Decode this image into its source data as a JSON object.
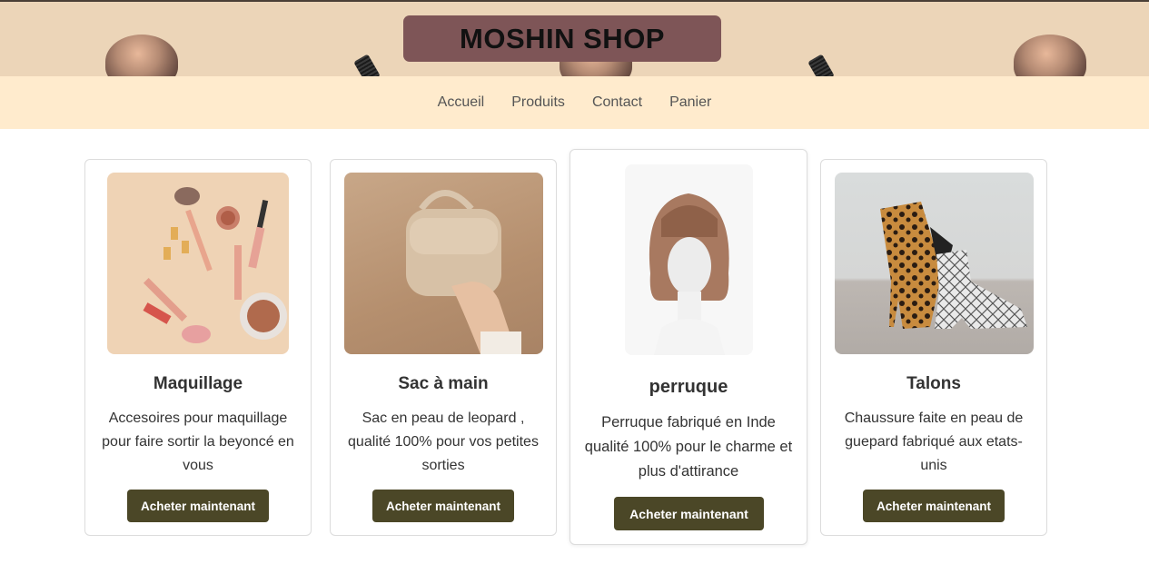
{
  "header": {
    "title": "MOSHIN SHOP"
  },
  "nav": {
    "items": [
      {
        "label": "Accueil"
      },
      {
        "label": "Produits"
      },
      {
        "label": "Contact"
      },
      {
        "label": "Panier"
      }
    ]
  },
  "products": [
    {
      "name": "Maquillage",
      "description": "Accesoires pour maquillage pour faire sortir la beyoncé en vous",
      "button_label": "Acheter maintenant",
      "image": "makeup-flatlay-image"
    },
    {
      "name": "Sac à main",
      "description": "Sac en peau de leopard , qualité 100% pour vos petites sorties",
      "button_label": "Acheter maintenant",
      "image": "handbag-image"
    },
    {
      "name": "perruque",
      "description": "Perruque fabriqué en Inde qualité 100% pour le charme et plus d'attirance",
      "button_label": "Acheter maintenant",
      "image": "wig-image"
    },
    {
      "name": "Talons",
      "description": "Chaussure faite en peau de guepard fabriqué aux etats-unis",
      "button_label": "Acheter maintenant",
      "image": "boots-image"
    }
  ],
  "colors": {
    "header_bg": "#ecd5b8",
    "title_box_bg": "#7e5557",
    "nav_bg": "#ffebcd",
    "button_bg": "#4b4727"
  }
}
